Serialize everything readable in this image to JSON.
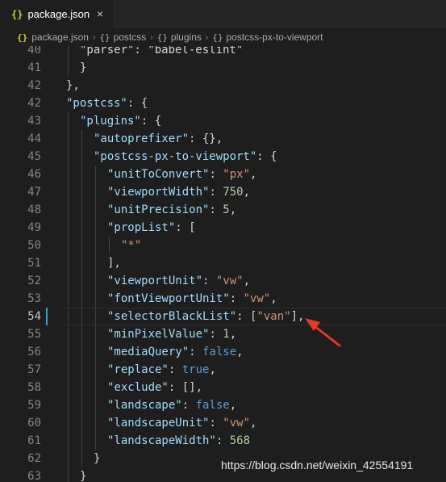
{
  "tab": {
    "title": "package.json",
    "icon": "{}",
    "close": "×"
  },
  "breadcrumb": [
    {
      "icon": "{}",
      "label": "package.json"
    },
    {
      "icon": "{}",
      "label": "postcss"
    },
    {
      "icon": "{}",
      "label": "plugins"
    },
    {
      "icon": "{}",
      "label": "postcss-px-to-viewport"
    }
  ],
  "editor": {
    "current_line": "54",
    "lines": [
      {
        "n": "40",
        "indent": 2,
        "tokens": [
          [
            "p",
            "\"parser\": \"babel-eslint\""
          ]
        ]
      },
      {
        "n": "41",
        "indent": 2,
        "tokens": [
          [
            "p",
            "}"
          ]
        ]
      },
      {
        "n": "42",
        "indent": 1,
        "tokens": [
          [
            "p",
            "},"
          ]
        ]
      },
      {
        "n": "42",
        "indent": 1,
        "tokens": [
          [
            "k",
            "\"postcss\""
          ],
          [
            "p",
            ": {"
          ]
        ]
      },
      {
        "n": "43",
        "indent": 2,
        "tokens": [
          [
            "k",
            "\"plugins\""
          ],
          [
            "p",
            ": {"
          ]
        ]
      },
      {
        "n": "44",
        "indent": 3,
        "tokens": [
          [
            "k",
            "\"autoprefixer\""
          ],
          [
            "p",
            ": {},"
          ]
        ]
      },
      {
        "n": "45",
        "indent": 3,
        "tokens": [
          [
            "k",
            "\"postcss-px-to-viewport\""
          ],
          [
            "p",
            ": {"
          ]
        ]
      },
      {
        "n": "46",
        "indent": 4,
        "tokens": [
          [
            "k",
            "\"unitToConvert\""
          ],
          [
            "p",
            ": "
          ],
          [
            "s",
            "\"px\""
          ],
          [
            "p",
            ","
          ]
        ]
      },
      {
        "n": "47",
        "indent": 4,
        "tokens": [
          [
            "k",
            "\"viewportWidth\""
          ],
          [
            "p",
            ": "
          ],
          [
            "n",
            "750"
          ],
          [
            "p",
            ","
          ]
        ]
      },
      {
        "n": "48",
        "indent": 4,
        "tokens": [
          [
            "k",
            "\"unitPrecision\""
          ],
          [
            "p",
            ": "
          ],
          [
            "n",
            "5"
          ],
          [
            "p",
            ","
          ]
        ]
      },
      {
        "n": "49",
        "indent": 4,
        "tokens": [
          [
            "k",
            "\"propList\""
          ],
          [
            "p",
            ": ["
          ]
        ]
      },
      {
        "n": "50",
        "indent": 5,
        "tokens": [
          [
            "s",
            "\"*\""
          ]
        ]
      },
      {
        "n": "51",
        "indent": 4,
        "tokens": [
          [
            "p",
            "],"
          ]
        ]
      },
      {
        "n": "52",
        "indent": 4,
        "tokens": [
          [
            "k",
            "\"viewportUnit\""
          ],
          [
            "p",
            ": "
          ],
          [
            "s",
            "\"vw\""
          ],
          [
            "p",
            ","
          ]
        ]
      },
      {
        "n": "53",
        "indent": 4,
        "tokens": [
          [
            "k",
            "\"fontViewportUnit\""
          ],
          [
            "p",
            ": "
          ],
          [
            "s",
            "\"vw\""
          ],
          [
            "p",
            ","
          ]
        ]
      },
      {
        "n": "54",
        "indent": 4,
        "tokens": [
          [
            "k",
            "\"selectorBlackList\""
          ],
          [
            "p",
            ": ["
          ],
          [
            "s",
            "\"van\""
          ],
          [
            "p",
            "],"
          ]
        ]
      },
      {
        "n": "55",
        "indent": 4,
        "tokens": [
          [
            "k",
            "\"minPixelValue\""
          ],
          [
            "p",
            ": "
          ],
          [
            "n",
            "1"
          ],
          [
            "p",
            ","
          ]
        ]
      },
      {
        "n": "56",
        "indent": 4,
        "tokens": [
          [
            "k",
            "\"mediaQuery\""
          ],
          [
            "p",
            ": "
          ],
          [
            "b",
            "false"
          ],
          [
            "p",
            ","
          ]
        ]
      },
      {
        "n": "57",
        "indent": 4,
        "tokens": [
          [
            "k",
            "\"replace\""
          ],
          [
            "p",
            ": "
          ],
          [
            "b",
            "true"
          ],
          [
            "p",
            ","
          ]
        ]
      },
      {
        "n": "58",
        "indent": 4,
        "tokens": [
          [
            "k",
            "\"exclude\""
          ],
          [
            "p",
            ": [],"
          ]
        ]
      },
      {
        "n": "59",
        "indent": 4,
        "tokens": [
          [
            "k",
            "\"landscape\""
          ],
          [
            "p",
            ": "
          ],
          [
            "b",
            "false"
          ],
          [
            "p",
            ","
          ]
        ]
      },
      {
        "n": "60",
        "indent": 4,
        "tokens": [
          [
            "k",
            "\"landscapeUnit\""
          ],
          [
            "p",
            ": "
          ],
          [
            "s",
            "\"vw\""
          ],
          [
            "p",
            ","
          ]
        ]
      },
      {
        "n": "61",
        "indent": 4,
        "tokens": [
          [
            "k",
            "\"landscapeWidth\""
          ],
          [
            "p",
            ": "
          ],
          [
            "n",
            "568"
          ]
        ]
      },
      {
        "n": "62",
        "indent": 3,
        "tokens": [
          [
            "p",
            "}"
          ]
        ]
      },
      {
        "n": "63",
        "indent": 2,
        "tokens": [
          [
            "p",
            "}"
          ]
        ]
      }
    ]
  },
  "watermark": "https://blog.csdn.net/weixin_42554191",
  "colors": {
    "background": "#1e1e1e",
    "property_key": "#9cdcfe",
    "string": "#ce9178",
    "number": "#b5cea8",
    "boolean": "#569cd6",
    "annotation_arrow": "#e8382a"
  }
}
